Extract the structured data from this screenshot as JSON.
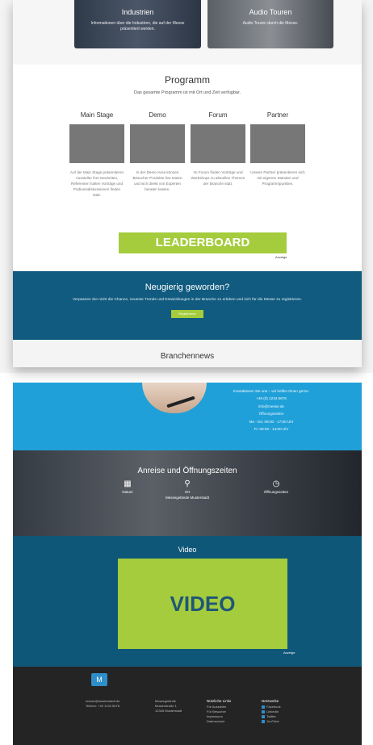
{
  "tiles": [
    {
      "title": "Industrien",
      "sub": "Informationen über die Industrien, die auf der Messe präsentiert werden."
    },
    {
      "title": "Audio Touren",
      "sub": "Audio Touren durch die Messe."
    }
  ],
  "programm": {
    "title": "Programm",
    "subtitle": "Das gesamte Programm ist mit Ort und Zeit verfügbar.",
    "columns": [
      {
        "head": "Main Stage",
        "text": "Auf der Main Stage präsentieren Aussteller ihre Neuheiten, Referenten halten Vorträge und Podiumsdiskussionen finden statt."
      },
      {
        "head": "Demo",
        "text": "In der Demo-Area können Besucher Produkte live testen und sich direkt von Experten beraten lassen."
      },
      {
        "head": "Forum",
        "text": "Im Forum finden Vorträge und Workshops zu aktuellen Themen der Branche statt."
      },
      {
        "head": "Partner",
        "text": "Unsere Partner präsentieren sich mit eigenen Ständen und Programmpunkten."
      }
    ]
  },
  "leaderboard": {
    "label": "LEADERBOARD",
    "caption": "Anzeige"
  },
  "neugierig": {
    "title": "Neugierig geworden?",
    "text": "Verpassen Sie nicht die Chance, neueste Trends und Entwicklungen in der Branche zu erleben und sich für die Messe zu registrieren.",
    "button": "Registrieren"
  },
  "branchennews": "Branchennews",
  "contact": {
    "lines": [
      "Kontaktieren Sie uns – wir helfen Ihnen gerne.",
      "+49 (0) 1234 5678",
      "info@messe.de",
      "Öffnungszeiten",
      "Mo - Do: 09:00 - 17:00 Uhr",
      "Fr: 09:00 - 14:00 Uhr"
    ]
  },
  "anreise": {
    "title": "Anreise und Öffnungszeiten",
    "items": [
      {
        "icon": "calendar-icon",
        "label": "Datum"
      },
      {
        "icon": "location-pin-icon",
        "label": "Ort"
      },
      {
        "icon": "clock-icon",
        "label": "Öffnungszeiten"
      }
    ],
    "sub_ort": "Messegelände Musterstadt"
  },
  "video": {
    "title": "Video",
    "label": "VIDEO",
    "caption": "Anzeige"
  },
  "footer": {
    "logo_char": "M",
    "contact": [
      "messe@musterstadt.de",
      "Telefon: +49 1234 5678"
    ],
    "col1": [
      "Messegelände",
      "Musterstraße 1",
      "12345 Musterstadt"
    ],
    "col2_head": "Nützliche Links",
    "col2": [
      "Für Aussteller",
      "Für Besucher",
      "Impressum",
      "Datenschutz"
    ],
    "col3_head": "Netzwerke",
    "col3": [
      "Facebook",
      "LinkedIn",
      "Twitter",
      "YouTube"
    ]
  },
  "colors": {
    "accent": "#a4cc3d",
    "blue_dark": "#105b7f",
    "blue_light": "#20a0d8",
    "footer": "#242424"
  }
}
